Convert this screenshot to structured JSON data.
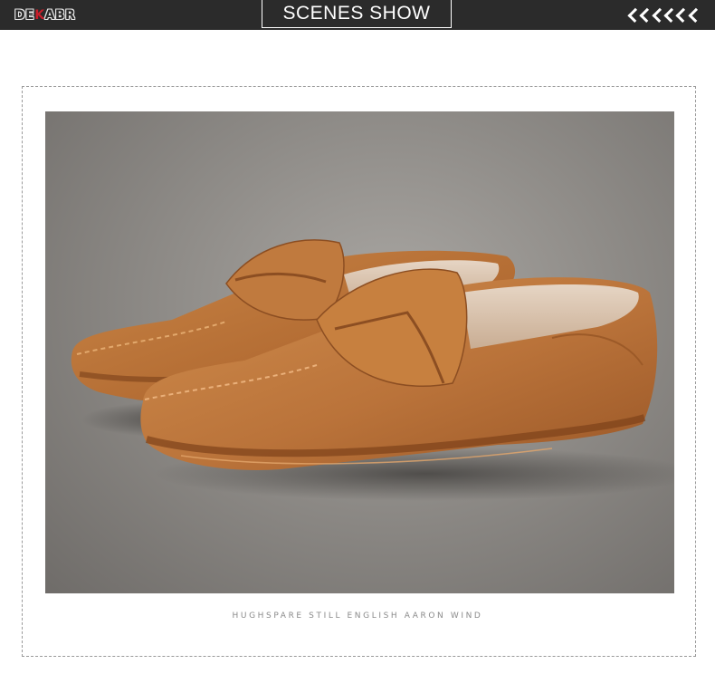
{
  "header": {
    "brand": {
      "main": "DE",
      "accent": "K",
      "rest": "ABR"
    },
    "title": "SCENES SHOW",
    "chevron_count": 6
  },
  "photo": {
    "subject": "tan suede penny loafers"
  },
  "caption": "HUGHSPARE STILL ENGLISH AARON WIND",
  "colors": {
    "header_bg": "#2b2b2b",
    "logo_accent": "#c81e2a",
    "suede": "#b8733a"
  }
}
